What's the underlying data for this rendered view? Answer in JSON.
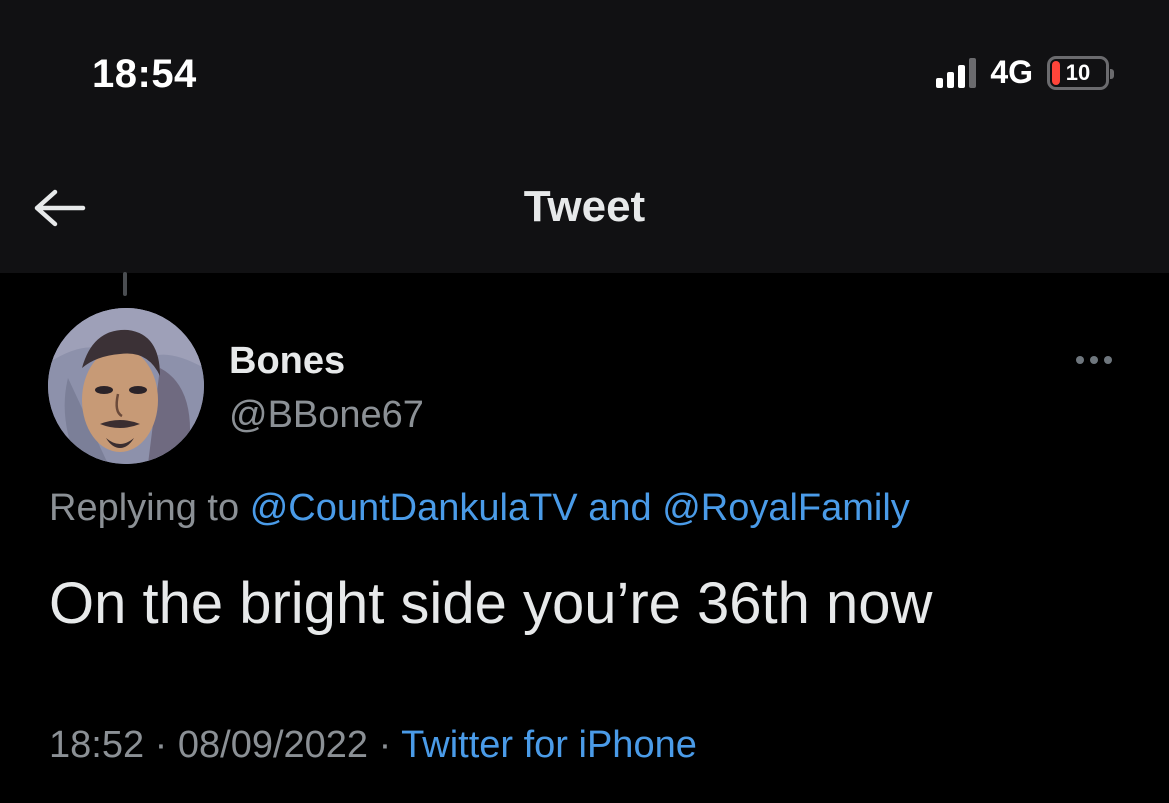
{
  "status_bar": {
    "time": "18:54",
    "network": "4G",
    "battery_level": "10",
    "battery_fraction": 0.1,
    "signal_bars_active": 3,
    "signal_bars_total": 4
  },
  "header": {
    "title": "Tweet",
    "back_icon": "arrow-left-icon"
  },
  "tweet": {
    "author": {
      "display_name": "Bones",
      "handle": "@BBone67"
    },
    "reply": {
      "prefix": "Replying to",
      "mention_1": "@CountDankulaTV",
      "joiner": "and",
      "mention_2": "@RoyalFamily"
    },
    "text": "On the bright side you’re 36th now",
    "meta": {
      "time": "18:52",
      "separator": "·",
      "date": "08/09/2022",
      "source": "Twitter for iPhone"
    },
    "more_icon": "more-horizontal-icon"
  },
  "colors": {
    "background": "#000000",
    "header_background": "#111113",
    "link": "#4a9be8",
    "secondary_text": "#8b9095",
    "primary_text": "#e7e9ea",
    "battery_low": "#ff453a"
  }
}
